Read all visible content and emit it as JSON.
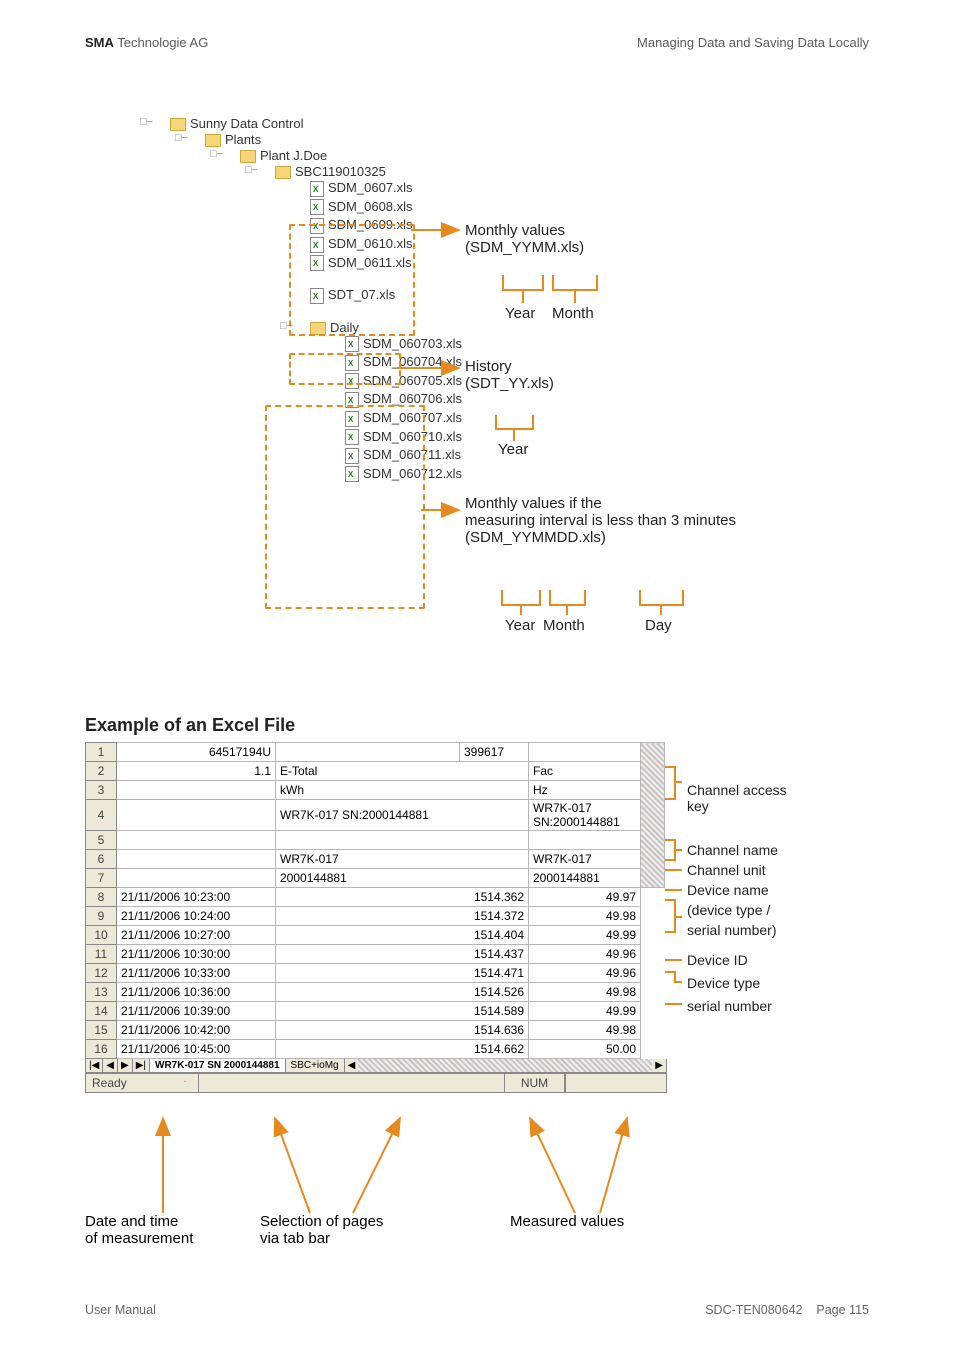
{
  "header": {
    "brand_bold": "SMA",
    "brand_rest": " Technologie AG",
    "right": "Managing Data and Saving Data Locally"
  },
  "tree": {
    "root": "Sunny Data Control",
    "plants": "Plants",
    "plant": "Plant J.Doe",
    "sbc": "SBC119010325",
    "monthly": [
      "SDM_0607.xls",
      "SDM_0608.xls",
      "SDM_0609.xls",
      "SDM_0610.xls",
      "SDM_0611.xls"
    ],
    "history": "SDT_07.xls",
    "daily": "Daily",
    "daily_files": [
      "SDM_060703.xls",
      "SDM_060704.xls",
      "SDM_060705.xls",
      "SDM_060706.xls",
      "SDM_060707.xls",
      "SDM_060710.xls",
      "SDM_060711.xls",
      "SDM_060712.xls"
    ]
  },
  "annot": {
    "monthly1": "Monthly values",
    "monthly2": "(SDM_YYMM.xls)",
    "year": "Year",
    "month": "Month",
    "history1": "History",
    "history2": "(SDT_YY.xls)",
    "daily1": "Monthly values if the",
    "daily2": "measuring interval is less than 3 minutes",
    "daily3": "(SDM_YYMMDD.xls)",
    "day": "Day"
  },
  "section": "Example of an Excel File",
  "excel": {
    "top_a": "64517194U",
    "top_b": "399617",
    "r2a": "1.1",
    "r2b": "E-Total",
    "r2c": "Fac",
    "r3b": "kWh",
    "r3c": "Hz",
    "r4b": "WR7K-017 SN:2000144881",
    "r4c": "WR7K-017 SN:2000144881",
    "r6b": "WR7K-017",
    "r6c": "WR7K-017",
    "r7b": "2000144881",
    "r7c": "2000144881",
    "rows": [
      {
        "n": "8",
        "t": "21/11/2006 10:23:00",
        "a": "1514.362",
        "b": "49.97"
      },
      {
        "n": "9",
        "t": "21/11/2006 10:24:00",
        "a": "1514.372",
        "b": "49.98"
      },
      {
        "n": "10",
        "t": "21/11/2006 10:27:00",
        "a": "1514.404",
        "b": "49.99"
      },
      {
        "n": "11",
        "t": "21/11/2006 10:30:00",
        "a": "1514.437",
        "b": "49.96"
      },
      {
        "n": "12",
        "t": "21/11/2006 10:33:00",
        "a": "1514.471",
        "b": "49.96"
      },
      {
        "n": "13",
        "t": "21/11/2006 10:36:00",
        "a": "1514.526",
        "b": "49.98"
      },
      {
        "n": "14",
        "t": "21/11/2006 10:39:00",
        "a": "1514.589",
        "b": "49.99"
      },
      {
        "n": "15",
        "t": "21/11/2006 10:42:00",
        "a": "1514.636",
        "b": "49.98"
      },
      {
        "n": "16",
        "t": "21/11/2006 10:45:00",
        "a": "1514.662",
        "b": "50.00"
      }
    ],
    "tab1_prefix": "WR7K-017 SN 2000144881",
    "tab2": "SBC+ioMg",
    "status_ready": "Ready",
    "status_num": "NUM",
    "nav_first": "|◀",
    "nav_prev": "◀",
    "nav_next": "▶",
    "nav_last": "▶|"
  },
  "right": {
    "channel_access1": "Channel access",
    "channel_access2": "key",
    "channel_name": "Channel name",
    "channel_unit": "Channel unit",
    "device_name": "Device name",
    "device_type1": "(device type /",
    "device_type2": "serial number)",
    "device_id": "Device ID",
    "dev_type": "Device type",
    "serial": "serial number"
  },
  "foot": {
    "l1": "Date and time",
    "l2": "of measurement",
    "m1": "Selection of pages",
    "m2": "via tab bar",
    "r1": "Measured values"
  },
  "pagefoot": {
    "left": "User Manual",
    "mid": "SDC-TEN080642",
    "page": "Page 115"
  }
}
